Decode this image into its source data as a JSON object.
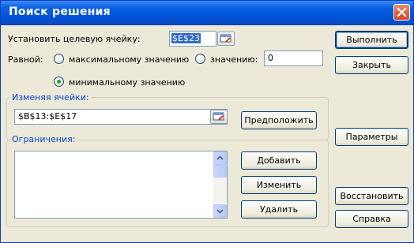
{
  "window": {
    "title": "Поиск решения"
  },
  "target": {
    "label": "Установить целевую ячейку:",
    "value": "$E$23"
  },
  "equal": {
    "label": "Равной:",
    "max_label": "максимальному значению",
    "value_label": "значению:",
    "value_input": "0",
    "min_label": "минимальному значению",
    "selected": "min"
  },
  "changing": {
    "group_label": "Изменяя ячейки:",
    "value": "$B$13:$E$17",
    "guess_button": "Предположить"
  },
  "constraints": {
    "group_label": "Ограничения:",
    "items": [],
    "add_button": "Добавить",
    "change_button": "Изменить",
    "delete_button": "Удалить"
  },
  "side": {
    "solve_button": "Выполнить",
    "close_button": "Закрыть",
    "options_button": "Параметры",
    "reset_button": "Восстановить",
    "help_button": "Справка"
  },
  "colors": {
    "titlebar": "#0a5fe3",
    "dialog_bg": "#ece9d8",
    "group_title": "#0046d5"
  }
}
